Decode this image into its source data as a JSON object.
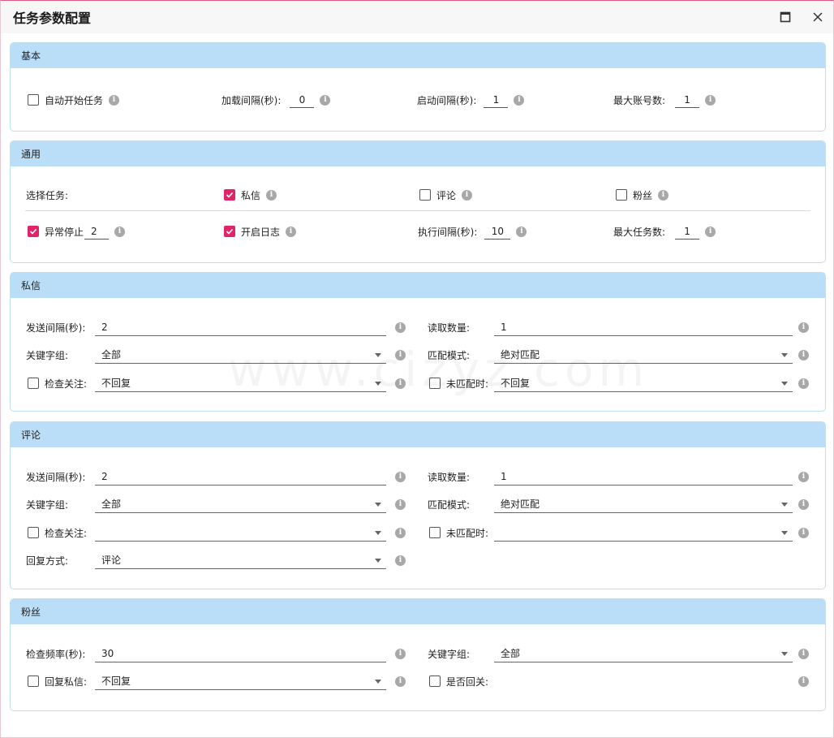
{
  "window": {
    "title": "任务参数配置"
  },
  "basic": {
    "header": "基本",
    "auto_start": {
      "label": "自动开始任务",
      "checked": false
    },
    "load_interval": {
      "label": "加载间隔(秒):",
      "value": "0"
    },
    "start_interval": {
      "label": "启动间隔(秒):",
      "value": "1"
    },
    "max_accounts": {
      "label": "最大账号数:",
      "value": "1"
    }
  },
  "general": {
    "header": "通用",
    "select_task_label": "选择任务:",
    "pm": {
      "label": "私信",
      "checked": true
    },
    "comment": {
      "label": "评论",
      "checked": false
    },
    "fans": {
      "label": "粉丝",
      "checked": false
    },
    "abnormal_stop": {
      "label": "异常停止",
      "value": "2",
      "checked": true
    },
    "enable_log": {
      "label": "开启日志",
      "checked": true
    },
    "exec_interval": {
      "label": "执行间隔(秒):",
      "value": "10"
    },
    "max_tasks": {
      "label": "最大任务数:",
      "value": "1"
    }
  },
  "private_message": {
    "header": "私信",
    "send_interval": {
      "label": "发送间隔(秒):",
      "value": "2"
    },
    "read_count": {
      "label": "读取数量:",
      "value": "1"
    },
    "keyword_group": {
      "label": "关键字组:",
      "value": "全部"
    },
    "match_mode": {
      "label": "匹配模式:",
      "value": "绝对匹配"
    },
    "check_follow": {
      "label": "检查关注:",
      "value": "不回复",
      "checked": false
    },
    "no_match": {
      "label": "未匹配时:",
      "value": "不回复",
      "checked": false
    }
  },
  "comment_section": {
    "header": "评论",
    "send_interval": {
      "label": "发送间隔(秒):",
      "value": "2"
    },
    "read_count": {
      "label": "读取数量:",
      "value": "1"
    },
    "keyword_group": {
      "label": "关键字组:",
      "value": "全部"
    },
    "match_mode": {
      "label": "匹配模式:",
      "value": "绝对匹配"
    },
    "check_follow": {
      "label": "检查关注:",
      "value": "",
      "checked": false
    },
    "no_match": {
      "label": "未匹配时:",
      "value": "",
      "checked": false
    },
    "reply_method": {
      "label": "回复方式:",
      "value": "评论"
    }
  },
  "fans_section": {
    "header": "粉丝",
    "check_freq": {
      "label": "检查频率(秒):",
      "value": "30"
    },
    "keyword_group": {
      "label": "关键字组:",
      "value": "全部"
    },
    "reply_pm": {
      "label": "回复私信:",
      "value": "不回复",
      "checked": false
    },
    "follow_back": {
      "label": "是否回关:",
      "checked": false
    }
  },
  "watermark": "www.cizyz.com",
  "colors": {
    "accent": "#e0246a",
    "section_header": "#bbdef8",
    "section_border": "#bfe0ea"
  },
  "icons": {
    "info": "info-icon",
    "maximize": "maximize-icon",
    "close": "close-icon",
    "dropdown": "chevron-down-icon",
    "check": "check-icon"
  }
}
